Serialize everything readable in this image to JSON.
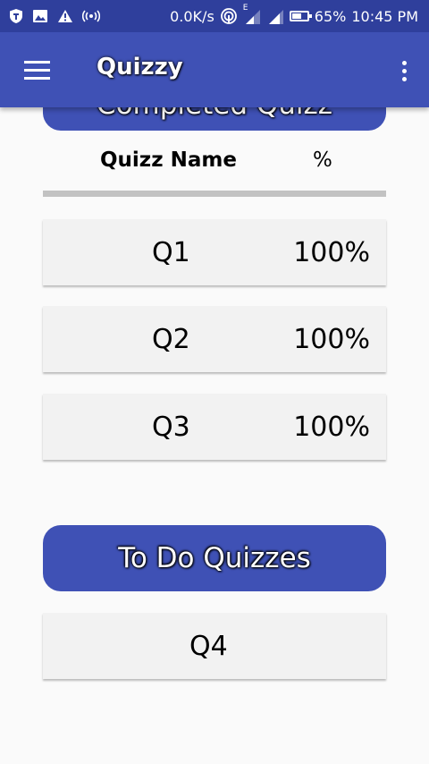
{
  "status_bar": {
    "speed": "0.0K/s",
    "network_type": "E",
    "battery": "65%",
    "battery_level": 0.65,
    "time": "10:45 PM",
    "icons": [
      "shield-icon",
      "image-icon",
      "warning-icon",
      "hotspot-icon",
      "nfc-icon",
      "signal-icon",
      "signal-icon",
      "battery-icon"
    ]
  },
  "app_bar": {
    "title": "Quizzy",
    "menu_icon": "hamburger-menu-icon",
    "overflow_icon": "more-vert-icon"
  },
  "completed": {
    "header": "Completed Quizz",
    "columns": {
      "name": "Quizz Name",
      "percent": "%"
    },
    "rows": [
      {
        "name": "Q1",
        "score": "100%"
      },
      {
        "name": "Q2",
        "score": "100%"
      },
      {
        "name": "Q3",
        "score": "100%"
      }
    ]
  },
  "todo": {
    "header": "To Do Quizzes",
    "rows": [
      {
        "name": "Q4"
      }
    ]
  },
  "colors": {
    "status_bar": "#2f3f9c",
    "primary": "#3f51b5",
    "row_background": "#f2f2f2",
    "divider": "#c2c2c2",
    "page_background": "#fafafa"
  }
}
